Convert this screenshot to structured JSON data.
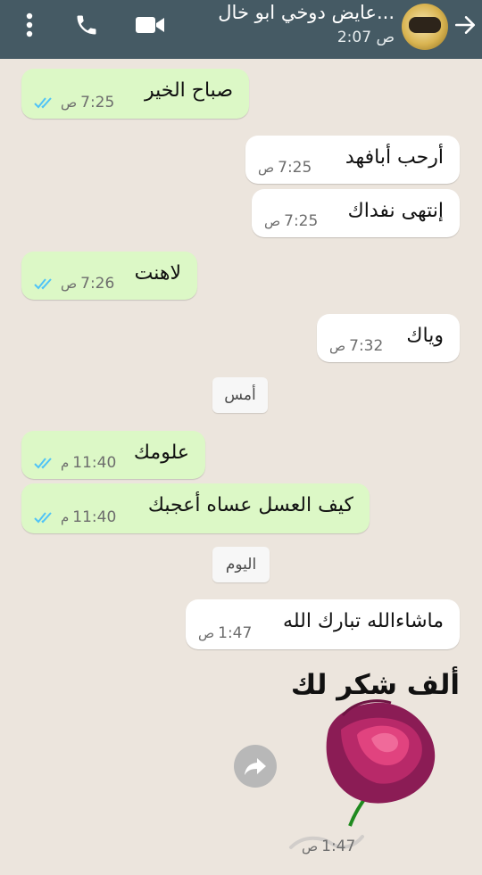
{
  "header": {
    "title": "عايض دوخي ابو خال...",
    "subtitle": "2:07 ص",
    "back_icon": "arrow-right-icon",
    "video_icon": "video-call-icon",
    "phone_icon": "phone-icon",
    "menu_icon": "kebab-menu-icon"
  },
  "messages": [
    {
      "text": "صباح الخير",
      "time": "7:25",
      "ampm": "ص",
      "type": "sent"
    },
    {
      "text": "أرحب أبافهد",
      "time": "7:25",
      "ampm": "ص",
      "type": "received"
    },
    {
      "text": "إنتهى نفداك",
      "time": "7:25",
      "ampm": "ص",
      "type": "received"
    },
    {
      "text": "لاهنت",
      "time": "7:26",
      "ampm": "ص",
      "type": "sent"
    },
    {
      "text": "وياك",
      "time": "7:32",
      "ampm": "ص",
      "type": "received"
    },
    {
      "text": "علومك",
      "time": "11:40",
      "ampm": "م",
      "type": "sent"
    },
    {
      "text": "كيف العسل عساه أعجبك",
      "time": "11:40",
      "ampm": "م",
      "type": "sent"
    },
    {
      "text": "ماشاءالله تبارك الله",
      "time": "1:47",
      "ampm": "ص",
      "type": "received"
    }
  ],
  "day_labels": [
    "أمس",
    "اليوم"
  ],
  "sticker": {
    "text": "ألف شكر لك",
    "time": "1:47",
    "ampm": "ص"
  },
  "colors": {
    "header": "#455a64",
    "sent": "#dcf8c6",
    "received": "#ffffff",
    "ticks": "#4fc3f7",
    "background": "#ece5dd"
  }
}
